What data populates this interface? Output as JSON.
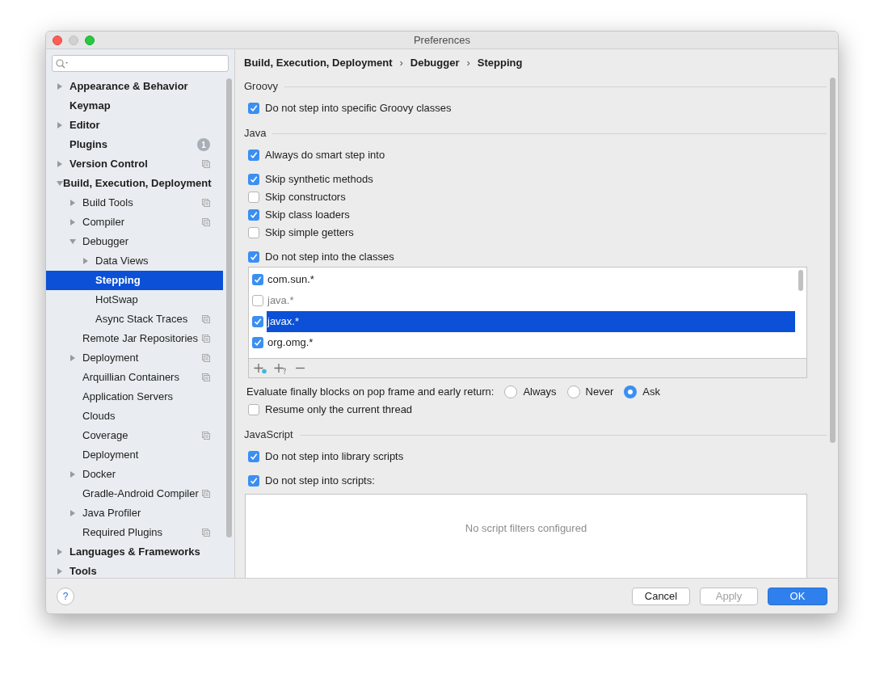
{
  "window": {
    "title": "Preferences"
  },
  "tree": [
    {
      "label": "Appearance & Behavior",
      "kind": "group",
      "expanded": false,
      "selected": false,
      "project": false
    },
    {
      "label": "Keymap",
      "kind": "page",
      "selected": false,
      "project": false
    },
    {
      "label": "Editor",
      "kind": "group",
      "expanded": false,
      "selected": false,
      "project": false
    },
    {
      "label": "Plugins",
      "kind": "page",
      "selected": false,
      "project": false,
      "badge": "1"
    },
    {
      "label": "Version Control",
      "kind": "group",
      "expanded": false,
      "selected": false,
      "project": true
    },
    {
      "label": "Build, Execution, Deployment",
      "kind": "group",
      "expanded": true,
      "selected": false,
      "project": false,
      "children": [
        {
          "label": "Build Tools",
          "kind": "group",
          "expanded": false,
          "selected": false,
          "project": true
        },
        {
          "label": "Compiler",
          "kind": "group",
          "expanded": false,
          "selected": false,
          "project": true
        },
        {
          "label": "Debugger",
          "kind": "group",
          "expanded": true,
          "selected": false,
          "project": false,
          "children": [
            {
              "label": "Data Views",
              "kind": "group",
              "expanded": false,
              "selected": false,
              "project": false
            },
            {
              "label": "Stepping",
              "kind": "page",
              "selected": true,
              "project": false
            },
            {
              "label": "HotSwap",
              "kind": "page",
              "selected": false,
              "project": false
            },
            {
              "label": "Async Stack Traces",
              "kind": "page",
              "selected": false,
              "project": true
            }
          ]
        },
        {
          "label": "Remote Jar Repositories",
          "kind": "page",
          "selected": false,
          "project": true
        },
        {
          "label": "Deployment",
          "kind": "group",
          "expanded": false,
          "selected": false,
          "project": true
        },
        {
          "label": "Arquillian Containers",
          "kind": "page",
          "selected": false,
          "project": true
        },
        {
          "label": "Application Servers",
          "kind": "page",
          "selected": false,
          "project": false
        },
        {
          "label": "Clouds",
          "kind": "page",
          "selected": false,
          "project": false
        },
        {
          "label": "Coverage",
          "kind": "page",
          "selected": false,
          "project": true
        },
        {
          "label": "Deployment",
          "kind": "page",
          "selected": false,
          "project": false
        },
        {
          "label": "Docker",
          "kind": "group",
          "expanded": false,
          "selected": false,
          "project": false
        },
        {
          "label": "Gradle-Android Compiler",
          "kind": "page",
          "selected": false,
          "project": true
        },
        {
          "label": "Java Profiler",
          "kind": "group",
          "expanded": false,
          "selected": false,
          "project": false
        },
        {
          "label": "Required Plugins",
          "kind": "page",
          "selected": false,
          "project": true
        }
      ]
    },
    {
      "label": "Languages & Frameworks",
      "kind": "group",
      "expanded": false,
      "selected": false,
      "project": false
    },
    {
      "label": "Tools",
      "kind": "group",
      "expanded": false,
      "selected": false,
      "project": false
    }
  ],
  "breadcrumb": {
    "separator": "›",
    "items": [
      "Build, Execution, Deployment",
      "Debugger",
      "Stepping"
    ]
  },
  "sections": [
    {
      "title": "Groovy",
      "groups": [
        [
          {
            "kind": "checkbox",
            "label": "Do not step into specific Groovy classes",
            "checked": true
          }
        ]
      ]
    },
    {
      "title": "Java",
      "groups": [
        [
          {
            "kind": "checkbox",
            "label": "Always do smart step into",
            "checked": true
          }
        ],
        [
          {
            "kind": "checkbox",
            "label": "Skip synthetic methods",
            "checked": true
          },
          {
            "kind": "checkbox",
            "label": "Skip constructors",
            "checked": false
          },
          {
            "kind": "checkbox",
            "label": "Skip class loaders",
            "checked": true
          },
          {
            "kind": "checkbox",
            "label": "Skip simple getters",
            "checked": false
          }
        ],
        [
          {
            "kind": "checkbox",
            "label": "Do not step into the classes",
            "checked": true
          },
          {
            "kind": "class_list",
            "items": [
              {
                "label": "com.sun.*",
                "checked": true,
                "selected": false
              },
              {
                "label": "java.*",
                "checked": false,
                "selected": false
              },
              {
                "label": "javax.*",
                "checked": true,
                "selected": true
              },
              {
                "label": "org.omg.*",
                "checked": true,
                "selected": false
              }
            ]
          },
          {
            "kind": "radio_group",
            "label": "Evaluate finally blocks on pop frame and early return:",
            "options": [
              {
                "label": "Always",
                "selected": false
              },
              {
                "label": "Never",
                "selected": false
              },
              {
                "label": "Ask",
                "selected": true
              }
            ]
          },
          {
            "kind": "checkbox",
            "label": "Resume only the current thread",
            "checked": false
          }
        ]
      ]
    },
    {
      "title": "JavaScript",
      "groups": [
        [
          {
            "kind": "checkbox",
            "label": "Do not step into library scripts",
            "checked": true
          }
        ],
        [
          {
            "kind": "checkbox",
            "label": "Do not step into scripts:",
            "checked": true
          },
          {
            "kind": "script_list",
            "empty_text": "No script filters configured"
          }
        ]
      ]
    }
  ],
  "help": "?",
  "buttons": [
    {
      "label": "Cancel",
      "kind": "default",
      "disabled": false
    },
    {
      "label": "Apply",
      "kind": "default",
      "disabled": true
    },
    {
      "label": "OK",
      "kind": "primary",
      "disabled": false
    }
  ]
}
